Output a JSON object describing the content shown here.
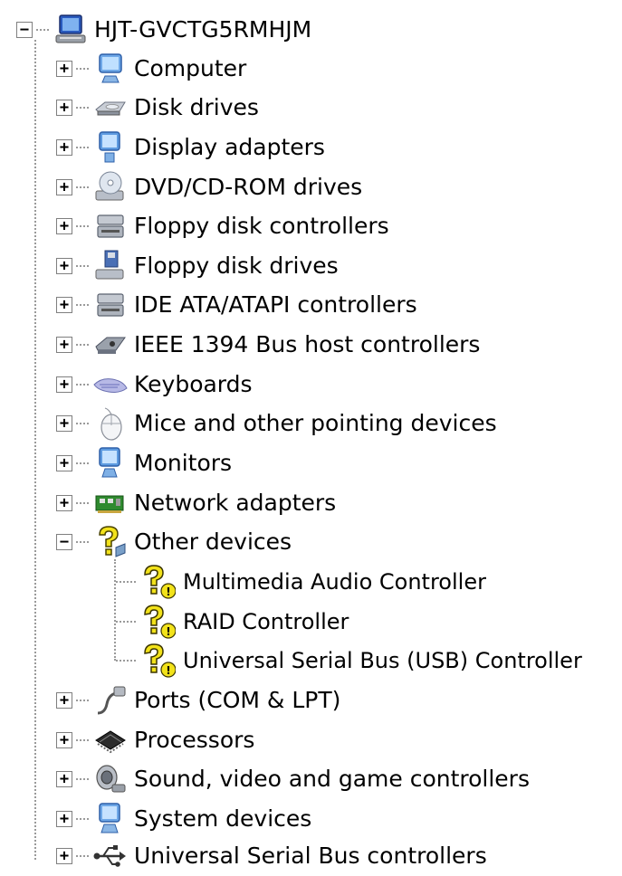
{
  "tree": {
    "root": {
      "label": "HJT-GVCTG5RMHJM",
      "icon": "computer-root-icon",
      "expanded": true
    },
    "categories": [
      {
        "label": "Computer",
        "icon": "computer-icon",
        "expanded": false
      },
      {
        "label": "Disk drives",
        "icon": "disk-drive-icon",
        "expanded": false
      },
      {
        "label": "Display adapters",
        "icon": "display-adapter-icon",
        "expanded": false
      },
      {
        "label": "DVD/CD-ROM drives",
        "icon": "cd-drive-icon",
        "expanded": false
      },
      {
        "label": "Floppy disk controllers",
        "icon": "controller-icon",
        "expanded": false
      },
      {
        "label": "Floppy disk drives",
        "icon": "floppy-drive-icon",
        "expanded": false
      },
      {
        "label": "IDE ATA/ATAPI controllers",
        "icon": "ide-controller-icon",
        "expanded": false
      },
      {
        "label": "IEEE 1394 Bus host controllers",
        "icon": "firewire-icon",
        "expanded": false
      },
      {
        "label": "Keyboards",
        "icon": "keyboard-icon",
        "expanded": false
      },
      {
        "label": "Mice and other pointing devices",
        "icon": "mouse-icon",
        "expanded": false
      },
      {
        "label": "Monitors",
        "icon": "monitor-icon",
        "expanded": false
      },
      {
        "label": "Network adapters",
        "icon": "network-adapter-icon",
        "expanded": false
      },
      {
        "label": "Other devices",
        "icon": "unknown-device-icon",
        "expanded": true,
        "children": [
          {
            "label": "Multimedia Audio Controller",
            "icon": "unknown-device-warning-icon"
          },
          {
            "label": "RAID Controller",
            "icon": "unknown-device-warning-icon"
          },
          {
            "label": "Universal Serial Bus (USB) Controller",
            "icon": "unknown-device-warning-icon"
          }
        ]
      },
      {
        "label": "Ports (COM & LPT)",
        "icon": "port-icon",
        "expanded": false
      },
      {
        "label": "Processors",
        "icon": "processor-icon",
        "expanded": false
      },
      {
        "label": "Sound, video and game controllers",
        "icon": "sound-icon",
        "expanded": false
      },
      {
        "label": "System devices",
        "icon": "system-device-icon",
        "expanded": false
      },
      {
        "label": "Universal Serial Bus controllers",
        "icon": "usb-icon",
        "expanded": false
      }
    ],
    "expand_symbol": "+",
    "collapse_symbol": "−"
  }
}
